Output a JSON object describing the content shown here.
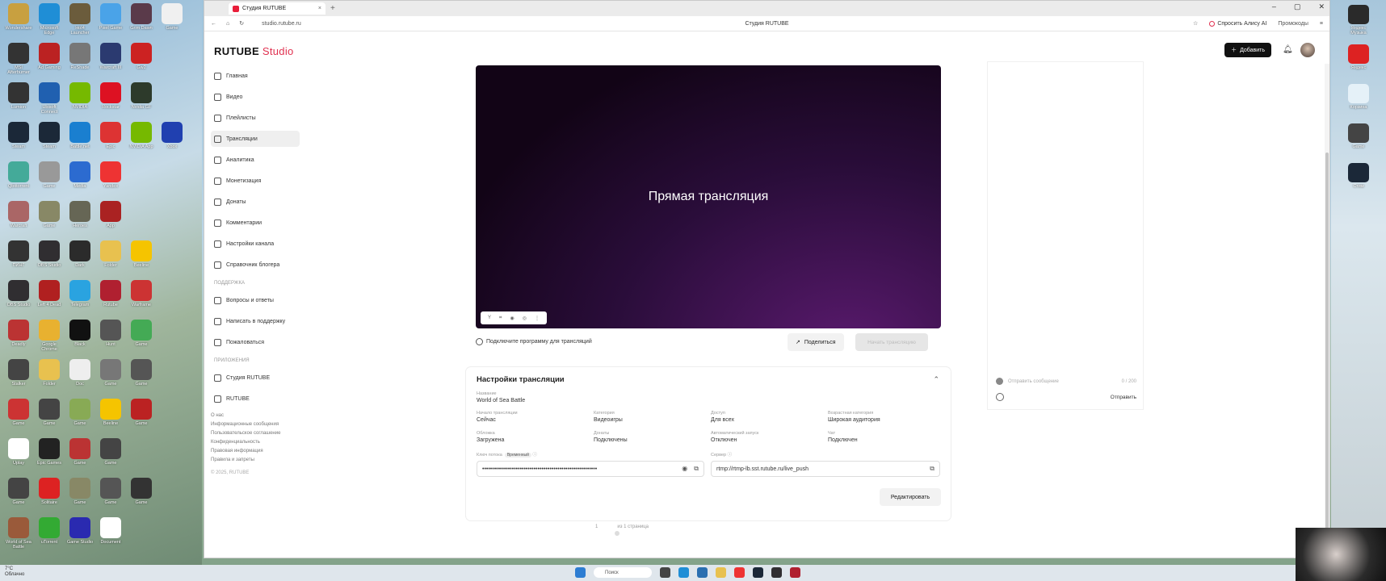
{
  "desktop": {
    "left_icons": [
      {
        "label": "Wondershare",
        "color": "#c8a040"
      },
      {
        "label": "Microsoft Edge",
        "color": "#1f8ed6"
      },
      {
        "label": "HoI4 Launcher",
        "color": "#6b5c3c"
      },
      {
        "label": "Pixel Game",
        "color": "#4aa3e8"
      },
      {
        "label": "Grim Dawn",
        "color": "#5a3a4a"
      },
      {
        "label": "Game",
        "color": "#f0f0f0"
      },
      {
        "label": "MSI Afterburner",
        "color": "#333"
      },
      {
        "label": "Ad Gaming",
        "color": "#b22"
      },
      {
        "label": "ReShade",
        "color": "#777"
      },
      {
        "label": "Warcraft III",
        "color": "#2b3a70"
      },
      {
        "label": "Gw2",
        "color": "#cc2222"
      },
      {
        "label": "",
        "color": "#ddd"
      },
      {
        "label": "Lumion",
        "color": "#333"
      },
      {
        "label": "Ubisoft Connect",
        "color": "#2060b0"
      },
      {
        "label": "NVIDIA",
        "color": "#76b900"
      },
      {
        "label": "Rockstar",
        "color": "#d12"
      },
      {
        "label": "Nvidia GF",
        "color": "#2d3a2b"
      },
      {
        "label": "",
        "color": "#ddd"
      },
      {
        "label": "Steam",
        "color": "#1b2838"
      },
      {
        "label": "Steam",
        "color": "#1b2838"
      },
      {
        "label": "Battle.net",
        "color": "#1a7fd0"
      },
      {
        "label": "Epic",
        "color": "#d33"
      },
      {
        "label": "NVIDIA App",
        "color": "#76b900"
      },
      {
        "label": "Xbox",
        "color": "#2040b0"
      },
      {
        "label": "Qbittorrent",
        "color": "#4a9"
      },
      {
        "label": "Game",
        "color": "#999"
      },
      {
        "label": "Media",
        "color": "#2c6bd0"
      },
      {
        "label": "Yandex",
        "color": "#e33"
      },
      {
        "label": "",
        "color": "#ddd"
      },
      {
        "label": "",
        "color": "#ddd"
      },
      {
        "label": "Warcraft",
        "color": "#a66"
      },
      {
        "label": "Game",
        "color": "#886"
      },
      {
        "label": "Heroes",
        "color": "#665"
      },
      {
        "label": "App",
        "color": "#a22"
      },
      {
        "label": "",
        "color": "#ddd"
      },
      {
        "label": "",
        "color": "#ddd"
      },
      {
        "label": "ПИНГ",
        "color": "#333"
      },
      {
        "label": "OBS Studio",
        "color": "#302e31"
      },
      {
        "label": "Dark",
        "color": "#2b2b2b"
      },
      {
        "label": "Folder",
        "color": "#e8c14f"
      },
      {
        "label": "Beeline",
        "color": "#f5c400"
      },
      {
        "label": "",
        "color": "#ddd"
      },
      {
        "label": "OBS Studio",
        "color": "#302e31"
      },
      {
        "label": "Left 4 Dead",
        "color": "#b02020"
      },
      {
        "label": "Telegram",
        "color": "#2aa3e0"
      },
      {
        "label": "Rutube",
        "color": "#b02030"
      },
      {
        "label": "Warframe",
        "color": "#c33"
      },
      {
        "label": "",
        "color": "#ddd"
      },
      {
        "label": "Deadly",
        "color": "#b33"
      },
      {
        "label": "Google Chrome",
        "color": "#e8b130"
      },
      {
        "label": "Black",
        "color": "#111"
      },
      {
        "label": "Hunt",
        "color": "#555"
      },
      {
        "label": "Game",
        "color": "#4a5"
      },
      {
        "label": "",
        "color": "#ddd"
      },
      {
        "label": "Stalker",
        "color": "#444"
      },
      {
        "label": "Folder",
        "color": "#e8c14f"
      },
      {
        "label": "Doc",
        "color": "#eee"
      },
      {
        "label": "Game",
        "color": "#777"
      },
      {
        "label": "Game",
        "color": "#555"
      },
      {
        "label": "",
        "color": "#ddd"
      },
      {
        "label": "Game",
        "color": "#c33"
      },
      {
        "label": "Game",
        "color": "#444"
      },
      {
        "label": "Game",
        "color": "#8a5"
      },
      {
        "label": "Beeline",
        "color": "#f5c400"
      },
      {
        "label": "Game",
        "color": "#b22"
      },
      {
        "label": "",
        "color": "#ddd"
      },
      {
        "label": "Uplay",
        "color": "#fff"
      },
      {
        "label": "Epic Games",
        "color": "#222"
      },
      {
        "label": "Game",
        "color": "#b33"
      },
      {
        "label": "Game",
        "color": "#444"
      },
      {
        "label": "",
        "color": "#ddd"
      },
      {
        "label": "",
        "color": "#ddd"
      },
      {
        "label": "Game",
        "color": "#444"
      },
      {
        "label": "Solitaire",
        "color": "#d22"
      },
      {
        "label": "Game",
        "color": "#886"
      },
      {
        "label": "Game",
        "color": "#555"
      },
      {
        "label": "Game",
        "color": "#333"
      },
      {
        "label": "",
        "color": "#ddd"
      },
      {
        "label": "World of Sea Battle",
        "color": "#9a5a3a"
      },
      {
        "label": "uTorrent",
        "color": "#3a3"
      },
      {
        "label": "Game Studio",
        "color": "#2a2ab0"
      },
      {
        "label": "Document",
        "color": "#fff"
      },
      {
        "label": "",
        "color": "#ddd"
      },
      {
        "label": "",
        "color": "#ddd"
      }
    ],
    "right_icons": [
      {
        "label": "Яндекс Музыка",
        "color": "#2a2a2a"
      },
      {
        "label": "Яндекс",
        "color": "#d22"
      },
      {
        "label": "Корзина",
        "color": "#e5f1f8"
      },
      {
        "label": "Game",
        "color": "#444"
      },
      {
        "label": "Стим",
        "color": "#1b2838"
      }
    ]
  },
  "browser": {
    "tab_title": "Студия RUTUBE",
    "url": "studio.rutube.ru",
    "page_title": "Студия RUTUBE",
    "alice_label": "Спросить Алису AI",
    "promo_label": "Промокоды"
  },
  "header": {
    "logo_main": "RUTUBE",
    "logo_suffix": "Studio",
    "add_button": "Добавить"
  },
  "sidebar": {
    "items": [
      {
        "label": "Главная"
      },
      {
        "label": "Видео"
      },
      {
        "label": "Плейлисты"
      },
      {
        "label": "Трансляции"
      },
      {
        "label": "Аналитика"
      },
      {
        "label": "Монетизация"
      },
      {
        "label": "Донаты"
      },
      {
        "label": "Комментарии"
      },
      {
        "label": "Настройки канала"
      },
      {
        "label": "Справочник блогера"
      }
    ],
    "support_heading": "Поддержка",
    "support_items": [
      {
        "label": "Вопросы и ответы"
      },
      {
        "label": "Написать в поддержку"
      },
      {
        "label": "Пожаловаться"
      }
    ],
    "apps_heading": "Приложения",
    "apps_items": [
      {
        "label": "Студия RUTUBE"
      },
      {
        "label": "RUTUBE"
      }
    ],
    "footer": [
      "О нас",
      "Информационные сообщения",
      "Пользовательское соглашение",
      "Конфиденциальность",
      "Правовая информация",
      "Правила и запреты"
    ],
    "copyright": "© 2025, RUTUBE"
  },
  "player": {
    "live_text": "Прямая трансляция",
    "connect_text": "Подключите программу для трансляций",
    "share_label": "Поделиться",
    "start_label": "Начать трансляцию"
  },
  "settings": {
    "title": "Настройки трансляции",
    "name_key": "Название",
    "name_value": "World of Sea Battle",
    "fields": [
      {
        "key": "Начало трансляции",
        "value": "Сейчас"
      },
      {
        "key": "Категория",
        "value": "Видеоигры"
      },
      {
        "key": "Доступ",
        "value": "Для всех"
      },
      {
        "key": "Возрастная категория",
        "value": "Широкая аудитория"
      },
      {
        "key": "Обложка",
        "value": "Загружена"
      },
      {
        "key": "Донаты",
        "value": "Подключены"
      },
      {
        "key": "Автоматический запуск",
        "value": "Отключен"
      },
      {
        "key": "Чат",
        "value": "Подключен"
      }
    ],
    "stream_key_label": "Ключ потока",
    "stream_key_badge": "Временный",
    "stream_key_value": "••••••••••••••••••••••••••••••••••••••••••••••••••••••••••",
    "server_label": "Сервер",
    "server_value": "rtmp://rtmp-lb.sst.rutube.ru/live_push",
    "edit_label": "Редактировать"
  },
  "pager": {
    "left": "1",
    "right": "из 1 страница"
  },
  "chat": {
    "placeholder": "Отправить сообщение",
    "counter": "0 / 200",
    "send_label": "Отправить"
  },
  "taskbar": {
    "weather_temp": "7°C",
    "weather_desc": "Облачно",
    "search_label": "Поиск"
  }
}
